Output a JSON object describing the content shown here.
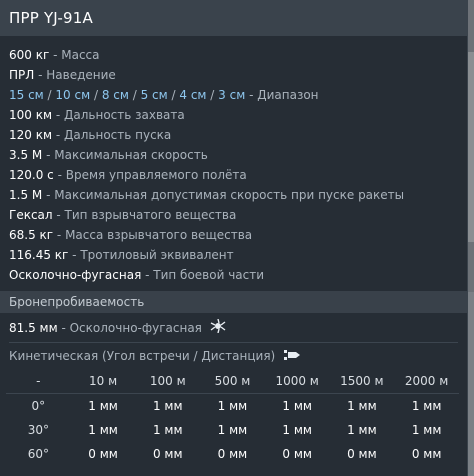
{
  "title": "ПРР YJ-91A",
  "properties": [
    {
      "value": "600 кг",
      "label": "Масса"
    },
    {
      "value": "ПРЛ",
      "label": "Наведение"
    },
    {
      "value": "",
      "label": "Диапазон"
    },
    {
      "value": "100 км",
      "label": "Дальность захвата"
    },
    {
      "value": "120 км",
      "label": "Дальность пуска"
    },
    {
      "value": "3.5 М",
      "label": "Максимальная скорость"
    },
    {
      "value": "120.0 с",
      "label": "Время управляемого полёта"
    },
    {
      "value": "1.5 М",
      "label": "Максимальная допустимая скорость при пуске ракеты"
    },
    {
      "value": "Гексал",
      "label": "Тип взрывчатого вещества"
    },
    {
      "value": "68.5 кг",
      "label": "Масса взрывчатого вещества"
    },
    {
      "value": "116.45 кг",
      "label": "Тротиловый эквивалент"
    },
    {
      "value": "Осколочно-фугасная",
      "label": "Тип боевой части"
    }
  ],
  "range_values": [
    "15 см",
    "10 см",
    "8 см",
    "5 см",
    "4 см",
    "3 см"
  ],
  "dash": " - ",
  "slash": " / ",
  "armor_section": {
    "title": "Бронепробиваемость",
    "he_value": "81.5 мм",
    "he_label": "Осколочно-фугасная",
    "he_icon": "explosion-icon",
    "kinetic_title": "Кинетическая (Угол встречи / Дистанция)",
    "kinetic_icon": "projectile-icon"
  },
  "table": {
    "corner": "-",
    "columns": [
      "10 м",
      "100 м",
      "500 м",
      "1000 м",
      "1500 м",
      "2000 м"
    ],
    "rows": [
      {
        "angle": "0°",
        "cells": [
          "1 мм",
          "1 мм",
          "1 мм",
          "1 мм",
          "1 мм",
          "1 мм"
        ]
      },
      {
        "angle": "30°",
        "cells": [
          "1 мм",
          "1 мм",
          "1 мм",
          "1 мм",
          "1 мм",
          "1 мм"
        ]
      },
      {
        "angle": "60°",
        "cells": [
          "0 мм",
          "0 мм",
          "0 мм",
          "0 мм",
          "0 мм",
          "0 мм"
        ]
      }
    ]
  },
  "colors": {
    "panel_bg": "#262d35",
    "header_bg": "#3a434c",
    "range_accent": "#8ec7ee",
    "label": "#aab3bc"
  }
}
